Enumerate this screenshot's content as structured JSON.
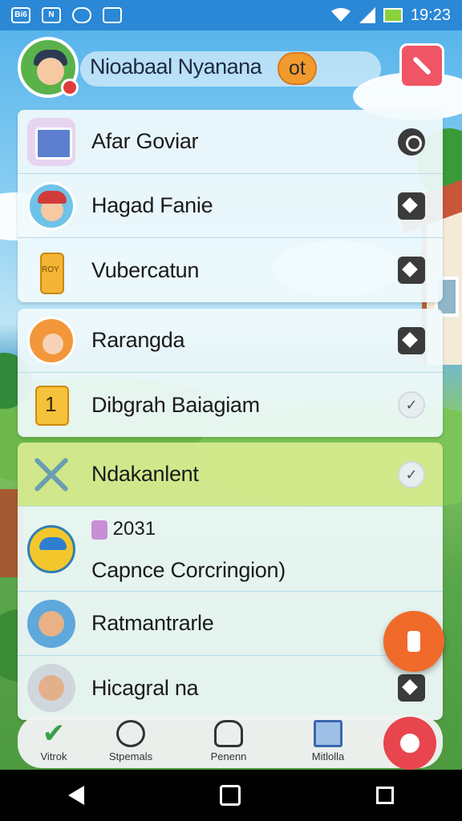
{
  "status_bar": {
    "left_icons": [
      "news-icon",
      "photo-icon",
      "shield-icon",
      "clipboard-icon"
    ],
    "time": "19:23",
    "badges": [
      "Bi6",
      "N",
      "",
      ""
    ]
  },
  "header": {
    "title": "Nioabaal Nyanana",
    "tag": "ot"
  },
  "cards": [
    {
      "rows": [
        {
          "label": "Afar Goviar",
          "icon": "document-icon",
          "action": "pin-icon"
        },
        {
          "label": "Hagad Fanie",
          "icon": "boy-avatar-icon",
          "action": "diamond-icon"
        },
        {
          "label": "Vubercatun",
          "icon": "bottle-icon",
          "action": "diamond-icon",
          "icon_text": "ROY"
        }
      ]
    },
    {
      "rows": [
        {
          "label": "Rarangda",
          "icon": "girl-avatar-icon",
          "action": "diamond-icon"
        },
        {
          "label": "Dibgrah Baiagiam",
          "icon": "number-one-icon",
          "action": "check-icon",
          "icon_text": "1"
        }
      ]
    },
    {
      "rows": [
        {
          "label": "Ndakanlent",
          "icon": "cross-icon",
          "action": "check-icon"
        },
        {
          "sub_label": "2031",
          "label": "Capnce Corcringion)",
          "icon": "cap-avatar-icon"
        },
        {
          "label": "Ratmantrarle",
          "icon": "man-avatar-icon"
        },
        {
          "label": "Hicagral  na",
          "icon": "man-avatar-icon",
          "action": "diamond-icon"
        }
      ]
    }
  ],
  "bottom_nav": [
    {
      "label": "Vitrok",
      "icon": "check-icon"
    },
    {
      "label": "Stpemals",
      "icon": "target-icon"
    },
    {
      "label": "Penenn",
      "icon": "cloud-icon"
    },
    {
      "label": "Mitlolla",
      "icon": "document-icon"
    }
  ],
  "colors": {
    "status_bar": "#2a88d6",
    "accent": "#ef5564",
    "fab": "#f06a2a",
    "highlight_row": "#cee682"
  }
}
